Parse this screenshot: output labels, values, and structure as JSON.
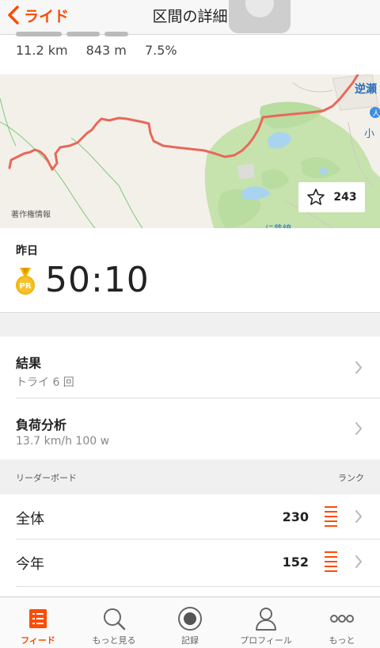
{
  "nav": {
    "back_label": "ライド",
    "title": "区間の詳細"
  },
  "segment_stats": {
    "distance": "11.2 km",
    "elevation": "843 m",
    "grade": "7.5%"
  },
  "map": {
    "copyright": "著作権情報",
    "star_count": "243",
    "place_label": "逆瀬",
    "place_label_2": "小",
    "place_label_3": "に鉄線",
    "route_color": "#e8685a",
    "water_color": "#a8d4f0",
    "park_color": "#b9dca0"
  },
  "effort": {
    "date": "昨日",
    "badge": "PR",
    "time": "50:10"
  },
  "rows": {
    "results_title": "結果",
    "results_sub": "トライ 6 回",
    "analysis_title": "負荷分析",
    "analysis_sub": "13.7 km/h 100 w"
  },
  "leaderboard": {
    "header": "リーダーボード",
    "rank_header": "ランク",
    "items": [
      {
        "label": "全体",
        "value": "230"
      },
      {
        "label": "今年",
        "value": "152"
      }
    ]
  },
  "tabbar": {
    "items": [
      {
        "label": "フィード",
        "icon": "feed-icon"
      },
      {
        "label": "もっと見る",
        "icon": "search-icon"
      },
      {
        "label": "記録",
        "icon": "record-icon"
      },
      {
        "label": "プロフィール",
        "icon": "profile-icon"
      },
      {
        "label": "もっと",
        "icon": "more-icon"
      }
    ]
  },
  "colors": {
    "accent": "#fc4c02",
    "pr_gold": "#f4b400"
  }
}
